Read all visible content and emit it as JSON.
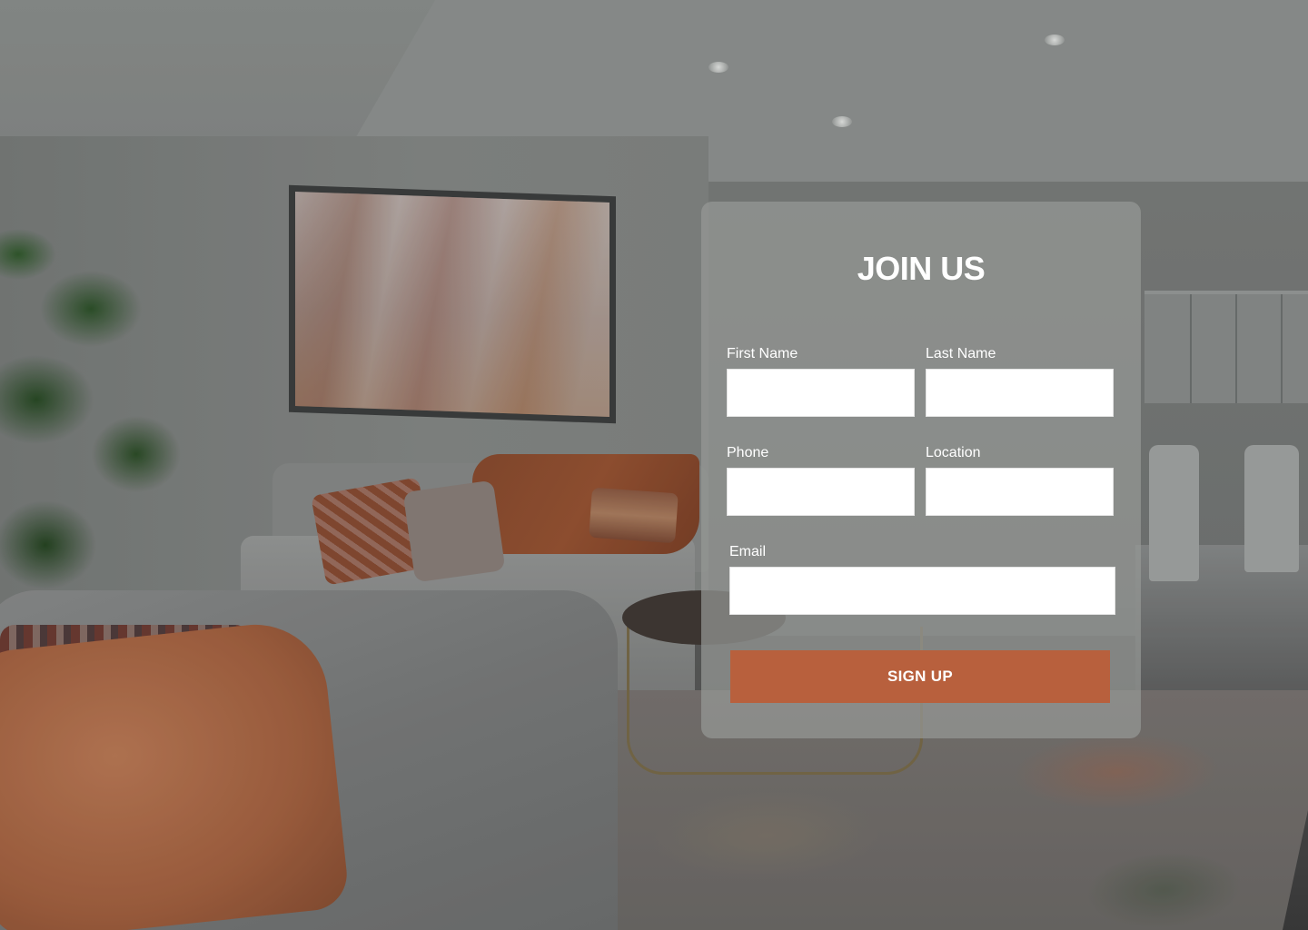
{
  "form": {
    "title": "JOIN US",
    "fields": {
      "first_name": {
        "label": "First Name",
        "value": "",
        "placeholder": ""
      },
      "last_name": {
        "label": "Last Name",
        "value": "",
        "placeholder": ""
      },
      "phone": {
        "label": "Phone",
        "value": "",
        "placeholder": ""
      },
      "location": {
        "label": "Location",
        "value": "",
        "placeholder": ""
      },
      "email": {
        "label": "Email",
        "value": "",
        "placeholder": ""
      }
    },
    "submit_label": "SIGN UP"
  },
  "colors": {
    "accent": "#b8603d",
    "card_background": "rgba(150,152,150,0.72)",
    "title_text": "#ffffff"
  }
}
